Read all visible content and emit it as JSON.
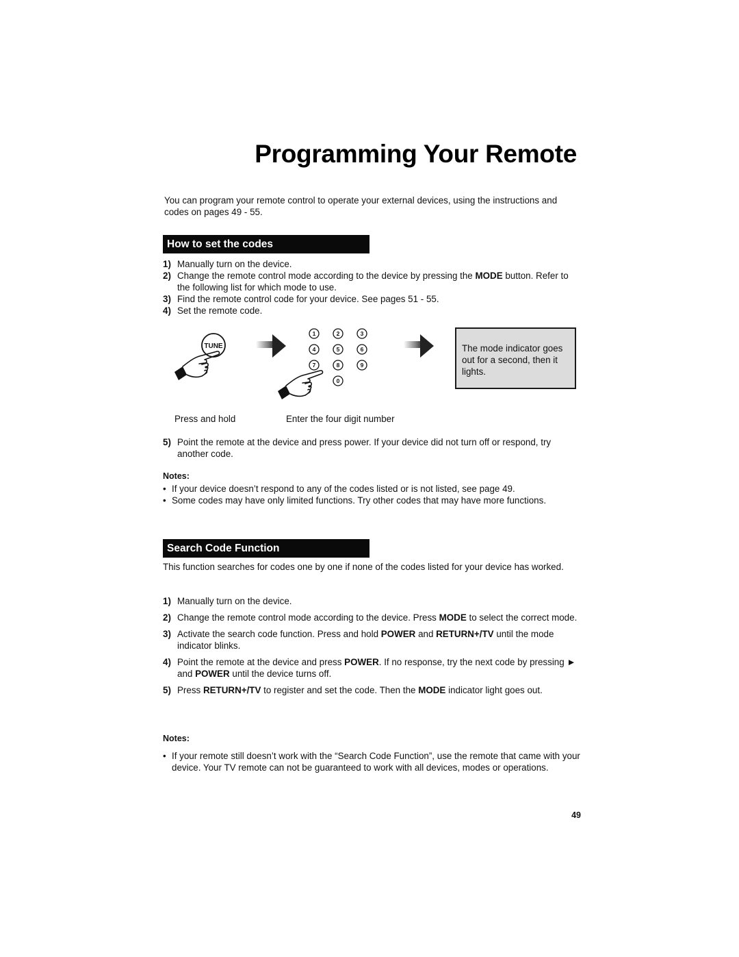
{
  "page": {
    "title": "Programming Your Remote",
    "intro": "You can program your remote control to operate your external devices, using the instructions and codes on pages 49 - 55.",
    "page_number": "49"
  },
  "how_to": {
    "heading": "How to set the codes",
    "steps": [
      {
        "num": "1)",
        "parts": [
          {
            "t": "Manually turn on the device."
          }
        ]
      },
      {
        "num": "2)",
        "parts": [
          {
            "t": "Change the remote control mode according to the device by pressing the "
          },
          {
            "t": "MODE",
            "b": true
          },
          {
            "t": " button. Refer to the following list for which mode to use."
          }
        ]
      },
      {
        "num": "3)",
        "parts": [
          {
            "t": "Find the remote control code for your device.  See pages 51 - 55."
          }
        ]
      },
      {
        "num": "4)",
        "parts": [
          {
            "t": "Set the remote code."
          }
        ]
      }
    ],
    "diagram": {
      "tune_button_label": "TUNE",
      "keypad_keys": [
        "1",
        "2",
        "3",
        "4",
        "5",
        "6",
        "7",
        "8",
        "9",
        "0"
      ],
      "mode_box_text": "The mode indicator goes out for a second, then it lights.",
      "caption_press_hold": "Press and hold",
      "caption_enter_number": "Enter the four digit number",
      "icons": [
        "hand-pointing-icon",
        "arrow-right-icon",
        "keypad-icon",
        "hand-pointing-icon",
        "arrow-right-icon"
      ]
    },
    "step5": {
      "num": "5)",
      "parts": [
        {
          "t": "Point the remote at the device and press power.  If your device did not turn off or respond, try another code."
        }
      ]
    },
    "notes_label": "Notes:",
    "notes": [
      "If your device doesn’t respond to any of the codes listed or is not listed, see page 49.",
      "Some codes may have only limited functions.  Try other codes that may have more functions."
    ]
  },
  "search_code": {
    "heading": "Search Code Function",
    "intro": "This function searches for codes one by one if none of the codes listed for your device has worked.",
    "steps": [
      {
        "num": "1)",
        "parts": [
          {
            "t": "Manually turn on the device."
          }
        ]
      },
      {
        "num": "2)",
        "parts": [
          {
            "t": "Change the remote control mode according to the device.  Press "
          },
          {
            "t": "MODE",
            "b": true
          },
          {
            "t": " to select the correct mode."
          }
        ]
      },
      {
        "num": "3)",
        "parts": [
          {
            "t": "Activate the search code function.  Press and hold "
          },
          {
            "t": "POWER",
            "b": true
          },
          {
            "t": " and "
          },
          {
            "t": "RETURN+/TV",
            "b": true
          },
          {
            "t": " until the mode indicator blinks."
          }
        ]
      },
      {
        "num": "4)",
        "parts": [
          {
            "t": "Point the remote at the device and press "
          },
          {
            "t": "POWER",
            "b": true
          },
          {
            "t": ".  If no response, try the next code by pressing ► and "
          },
          {
            "t": "POWER",
            "b": true
          },
          {
            "t": " until the device turns off."
          }
        ]
      },
      {
        "num": "5)",
        "parts": [
          {
            "t": "Press "
          },
          {
            "t": "RETURN+/TV",
            "b": true
          },
          {
            "t": " to register and set the code.  Then the "
          },
          {
            "t": "MODE",
            "b": true
          },
          {
            "t": " indicator light goes out."
          }
        ]
      }
    ],
    "notes_label": "Notes:",
    "notes": [
      "If your remote still doesn’t work with the “Search Code Function”, use the remote that came with your device.  Your TV remote can not be guaranteed to work with all devices, modes or operations."
    ]
  }
}
